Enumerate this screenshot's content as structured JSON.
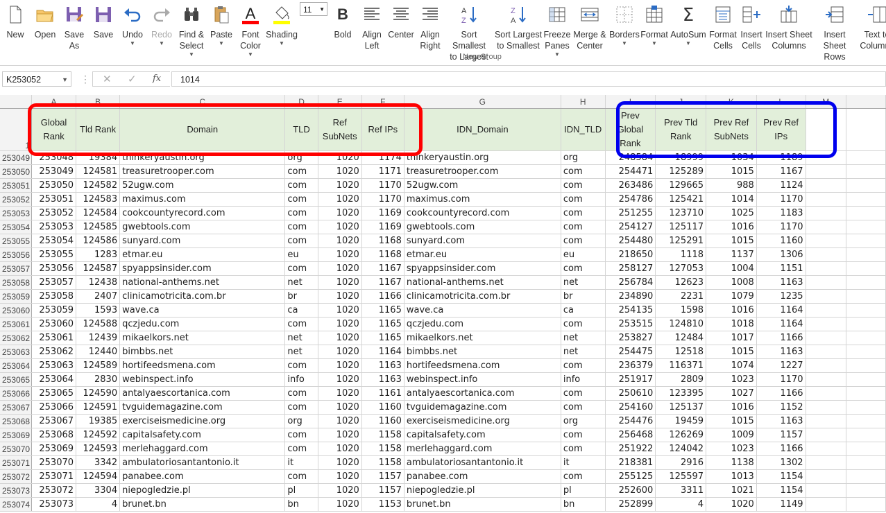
{
  "ribbon": {
    "buttons": [
      {
        "name": "new-button",
        "label": "New",
        "icon": "new-doc-icon"
      },
      {
        "name": "open-button",
        "label": "Open",
        "icon": "folder-icon"
      },
      {
        "name": "save-as-button",
        "label": "Save\nAs",
        "icon": "save-as-icon"
      },
      {
        "name": "save-button",
        "label": "Save",
        "icon": "save-icon"
      },
      {
        "name": "undo-button",
        "label": "Undo",
        "icon": "undo-icon"
      },
      {
        "name": "redo-button",
        "label": "Redo",
        "icon": "redo-icon"
      },
      {
        "name": "find-select-button",
        "label": "Find &\nSelect",
        "icon": "binoculars-icon"
      },
      {
        "name": "paste-button",
        "label": "Paste",
        "icon": "paste-icon"
      },
      {
        "name": "font-color-button",
        "label": "Font\nColor",
        "icon": "font-color-icon"
      },
      {
        "name": "shading-button",
        "label": "Shading",
        "icon": "paint-bucket-icon"
      },
      {
        "name": "font-size-select",
        "label": "11",
        "icon": "font-size-icon"
      },
      {
        "name": "bold-button",
        "label": "Bold",
        "icon": "bold-icon"
      },
      {
        "name": "align-left-button",
        "label": "Align\nLeft",
        "icon": "align-left-icon"
      },
      {
        "name": "center-button",
        "label": "Center",
        "icon": "align-center-icon"
      },
      {
        "name": "align-right-button",
        "label": "Align\nRight",
        "icon": "align-right-icon"
      },
      {
        "name": "sort-smallest-button",
        "label": "Sort Smallest\nto Largest",
        "icon": "sort-az-icon"
      },
      {
        "name": "sort-largest-button",
        "label": "Sort Largest\nto Smallest",
        "icon": "sort-za-icon"
      },
      {
        "name": "freeze-panes-button",
        "label": "Freeze\nPanes",
        "icon": "freeze-panes-icon"
      },
      {
        "name": "merge-center-button",
        "label": "Merge &\nCenter",
        "icon": "merge-icon"
      },
      {
        "name": "borders-button",
        "label": "Borders",
        "icon": "borders-icon"
      },
      {
        "name": "format-button",
        "label": "Format",
        "icon": "format-icon"
      },
      {
        "name": "autosum-button",
        "label": "AutoSum",
        "icon": "sigma-icon"
      },
      {
        "name": "format-cells-button",
        "label": "Format\nCells",
        "icon": "format-cells-icon"
      },
      {
        "name": "insert-cells-button",
        "label": "Insert\nCells",
        "icon": "insert-cells-icon"
      },
      {
        "name": "insert-sheet-columns-button",
        "label": "Insert Sheet\nColumns",
        "icon": "insert-columns-icon"
      },
      {
        "name": "insert-sheet-rows-button",
        "label": "Insert\nSheet Rows",
        "icon": "insert-rows-icon"
      },
      {
        "name": "text-to-columns-button",
        "label": "Text to\nColumns",
        "icon": "text-to-columns-icon"
      }
    ],
    "group_label": "New Group",
    "font_size": "11"
  },
  "formula_bar": {
    "name_box": "K253052",
    "fx": "fx",
    "value": "1014"
  },
  "columns": [
    "A",
    "B",
    "C",
    "D",
    "E",
    "F",
    "G",
    "H",
    "I",
    "J",
    "K",
    "L",
    "M"
  ],
  "headers": [
    "Global Rank",
    "Tld Rank",
    "Domain",
    "TLD",
    "Ref SubNets",
    "Ref IPs",
    "IDN_Domain",
    "IDN_TLD",
    "Prev Global Rank",
    "Prev Tld Rank",
    "Prev Ref SubNets",
    "Prev Ref IPs",
    ""
  ],
  "header_row_number": "1",
  "rows": [
    [
      "253049",
      "253048",
      "19384",
      "thinkeryaustin.org",
      "org",
      "1020",
      "1174",
      "thinkeryaustin.org",
      "org",
      "248584",
      "18999",
      "1034",
      "1189"
    ],
    [
      "253050",
      "253049",
      "124581",
      "treasuretrooper.com",
      "com",
      "1020",
      "1171",
      "treasuretrooper.com",
      "com",
      "254471",
      "125289",
      "1015",
      "1167"
    ],
    [
      "253051",
      "253050",
      "124582",
      "52ugw.com",
      "com",
      "1020",
      "1170",
      "52ugw.com",
      "com",
      "263486",
      "129665",
      "988",
      "1124"
    ],
    [
      "253052",
      "253051",
      "124583",
      "maximus.com",
      "com",
      "1020",
      "1170",
      "maximus.com",
      "com",
      "254786",
      "125421",
      "1014",
      "1170"
    ],
    [
      "253053",
      "253052",
      "124584",
      "cookcountyrecord.com",
      "com",
      "1020",
      "1169",
      "cookcountyrecord.com",
      "com",
      "251255",
      "123710",
      "1025",
      "1183"
    ],
    [
      "253054",
      "253053",
      "124585",
      "gwebtools.com",
      "com",
      "1020",
      "1169",
      "gwebtools.com",
      "com",
      "254127",
      "125117",
      "1016",
      "1170"
    ],
    [
      "253055",
      "253054",
      "124586",
      "sunyard.com",
      "com",
      "1020",
      "1168",
      "sunyard.com",
      "com",
      "254480",
      "125291",
      "1015",
      "1160"
    ],
    [
      "253056",
      "253055",
      "1283",
      "etmar.eu",
      "eu",
      "1020",
      "1168",
      "etmar.eu",
      "eu",
      "218650",
      "1118",
      "1137",
      "1306"
    ],
    [
      "253057",
      "253056",
      "124587",
      "spyappsinsider.com",
      "com",
      "1020",
      "1167",
      "spyappsinsider.com",
      "com",
      "258127",
      "127053",
      "1004",
      "1151"
    ],
    [
      "253058",
      "253057",
      "12438",
      "national-anthems.net",
      "net",
      "1020",
      "1167",
      "national-anthems.net",
      "net",
      "256784",
      "12623",
      "1008",
      "1163"
    ],
    [
      "253059",
      "253058",
      "2407",
      "clinicamotricita.com.br",
      "br",
      "1020",
      "1166",
      "clinicamotricita.com.br",
      "br",
      "234890",
      "2231",
      "1079",
      "1235"
    ],
    [
      "253060",
      "253059",
      "1593",
      "wave.ca",
      "ca",
      "1020",
      "1165",
      "wave.ca",
      "ca",
      "254135",
      "1598",
      "1016",
      "1164"
    ],
    [
      "253061",
      "253060",
      "124588",
      "qczjedu.com",
      "com",
      "1020",
      "1165",
      "qczjedu.com",
      "com",
      "253515",
      "124810",
      "1018",
      "1164"
    ],
    [
      "253062",
      "253061",
      "12439",
      "mikaelkors.net",
      "net",
      "1020",
      "1165",
      "mikaelkors.net",
      "net",
      "253827",
      "12484",
      "1017",
      "1166"
    ],
    [
      "253063",
      "253062",
      "12440",
      "bimbbs.net",
      "net",
      "1020",
      "1164",
      "bimbbs.net",
      "net",
      "254475",
      "12518",
      "1015",
      "1163"
    ],
    [
      "253064",
      "253063",
      "124589",
      "hortifeedsmena.com",
      "com",
      "1020",
      "1163",
      "hortifeedsmena.com",
      "com",
      "236379",
      "116371",
      "1074",
      "1227"
    ],
    [
      "253065",
      "253064",
      "2830",
      "webinspect.info",
      "info",
      "1020",
      "1163",
      "webinspect.info",
      "info",
      "251917",
      "2809",
      "1023",
      "1170"
    ],
    [
      "253066",
      "253065",
      "124590",
      "antalyaescortanica.com",
      "com",
      "1020",
      "1161",
      "antalyaescortanica.com",
      "com",
      "250610",
      "123395",
      "1027",
      "1166"
    ],
    [
      "253067",
      "253066",
      "124591",
      "tvguidemagazine.com",
      "com",
      "1020",
      "1160",
      "tvguidemagazine.com",
      "com",
      "254160",
      "125137",
      "1016",
      "1152"
    ],
    [
      "253068",
      "253067",
      "19385",
      "exerciseismedicine.org",
      "org",
      "1020",
      "1160",
      "exerciseismedicine.org",
      "org",
      "254476",
      "19459",
      "1015",
      "1163"
    ],
    [
      "253069",
      "253068",
      "124592",
      "capitalsafety.com",
      "com",
      "1020",
      "1158",
      "capitalsafety.com",
      "com",
      "256468",
      "126269",
      "1009",
      "1157"
    ],
    [
      "253070",
      "253069",
      "124593",
      "merlehaggard.com",
      "com",
      "1020",
      "1158",
      "merlehaggard.com",
      "com",
      "251922",
      "124042",
      "1023",
      "1166"
    ],
    [
      "253071",
      "253070",
      "3342",
      "ambulatoriosantantonio.it",
      "it",
      "1020",
      "1158",
      "ambulatoriosantantonio.it",
      "it",
      "218381",
      "2916",
      "1138",
      "1302"
    ],
    [
      "253072",
      "253071",
      "124594",
      "panabee.com",
      "com",
      "1020",
      "1157",
      "panabee.com",
      "com",
      "255125",
      "125597",
      "1013",
      "1154"
    ],
    [
      "253073",
      "253072",
      "3304",
      "niepogledzie.pl",
      "pl",
      "1020",
      "1157",
      "niepogledzie.pl",
      "pl",
      "252600",
      "3311",
      "1021",
      "1154"
    ],
    [
      "253074",
      "253073",
      "4",
      "brunet.bn",
      "bn",
      "1020",
      "1153",
      "brunet.bn",
      "bn",
      "252899",
      "4",
      "1020",
      "1149"
    ]
  ],
  "colors": {
    "header_fill": "#e2efda",
    "red_box": "#ff0000",
    "blue_box": "#0000ee",
    "font_color_bar": "#ff0000",
    "shading_bar": "#ffff00"
  }
}
